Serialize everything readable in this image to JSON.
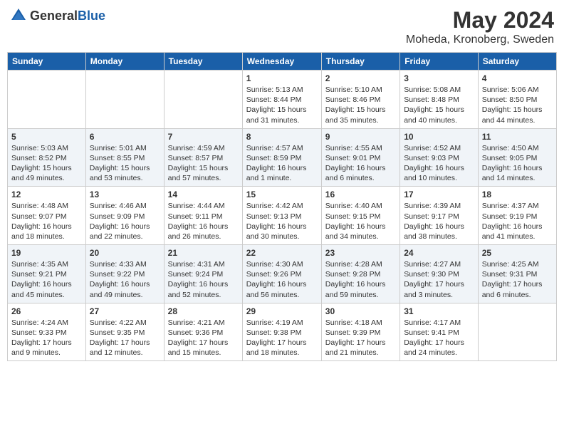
{
  "header": {
    "logo_general": "General",
    "logo_blue": "Blue",
    "month_year": "May 2024",
    "location": "Moheda, Kronoberg, Sweden"
  },
  "days_of_week": [
    "Sunday",
    "Monday",
    "Tuesday",
    "Wednesday",
    "Thursday",
    "Friday",
    "Saturday"
  ],
  "weeks": [
    [
      {
        "day": "",
        "info": ""
      },
      {
        "day": "",
        "info": ""
      },
      {
        "day": "",
        "info": ""
      },
      {
        "day": "1",
        "info": "Sunrise: 5:13 AM\nSunset: 8:44 PM\nDaylight: 15 hours and 31 minutes."
      },
      {
        "day": "2",
        "info": "Sunrise: 5:10 AM\nSunset: 8:46 PM\nDaylight: 15 hours and 35 minutes."
      },
      {
        "day": "3",
        "info": "Sunrise: 5:08 AM\nSunset: 8:48 PM\nDaylight: 15 hours and 40 minutes."
      },
      {
        "day": "4",
        "info": "Sunrise: 5:06 AM\nSunset: 8:50 PM\nDaylight: 15 hours and 44 minutes."
      }
    ],
    [
      {
        "day": "5",
        "info": "Sunrise: 5:03 AM\nSunset: 8:52 PM\nDaylight: 15 hours and 49 minutes."
      },
      {
        "day": "6",
        "info": "Sunrise: 5:01 AM\nSunset: 8:55 PM\nDaylight: 15 hours and 53 minutes."
      },
      {
        "day": "7",
        "info": "Sunrise: 4:59 AM\nSunset: 8:57 PM\nDaylight: 15 hours and 57 minutes."
      },
      {
        "day": "8",
        "info": "Sunrise: 4:57 AM\nSunset: 8:59 PM\nDaylight: 16 hours and 1 minute."
      },
      {
        "day": "9",
        "info": "Sunrise: 4:55 AM\nSunset: 9:01 PM\nDaylight: 16 hours and 6 minutes."
      },
      {
        "day": "10",
        "info": "Sunrise: 4:52 AM\nSunset: 9:03 PM\nDaylight: 16 hours and 10 minutes."
      },
      {
        "day": "11",
        "info": "Sunrise: 4:50 AM\nSunset: 9:05 PM\nDaylight: 16 hours and 14 minutes."
      }
    ],
    [
      {
        "day": "12",
        "info": "Sunrise: 4:48 AM\nSunset: 9:07 PM\nDaylight: 16 hours and 18 minutes."
      },
      {
        "day": "13",
        "info": "Sunrise: 4:46 AM\nSunset: 9:09 PM\nDaylight: 16 hours and 22 minutes."
      },
      {
        "day": "14",
        "info": "Sunrise: 4:44 AM\nSunset: 9:11 PM\nDaylight: 16 hours and 26 minutes."
      },
      {
        "day": "15",
        "info": "Sunrise: 4:42 AM\nSunset: 9:13 PM\nDaylight: 16 hours and 30 minutes."
      },
      {
        "day": "16",
        "info": "Sunrise: 4:40 AM\nSunset: 9:15 PM\nDaylight: 16 hours and 34 minutes."
      },
      {
        "day": "17",
        "info": "Sunrise: 4:39 AM\nSunset: 9:17 PM\nDaylight: 16 hours and 38 minutes."
      },
      {
        "day": "18",
        "info": "Sunrise: 4:37 AM\nSunset: 9:19 PM\nDaylight: 16 hours and 41 minutes."
      }
    ],
    [
      {
        "day": "19",
        "info": "Sunrise: 4:35 AM\nSunset: 9:21 PM\nDaylight: 16 hours and 45 minutes."
      },
      {
        "day": "20",
        "info": "Sunrise: 4:33 AM\nSunset: 9:22 PM\nDaylight: 16 hours and 49 minutes."
      },
      {
        "day": "21",
        "info": "Sunrise: 4:31 AM\nSunset: 9:24 PM\nDaylight: 16 hours and 52 minutes."
      },
      {
        "day": "22",
        "info": "Sunrise: 4:30 AM\nSunset: 9:26 PM\nDaylight: 16 hours and 56 minutes."
      },
      {
        "day": "23",
        "info": "Sunrise: 4:28 AM\nSunset: 9:28 PM\nDaylight: 16 hours and 59 minutes."
      },
      {
        "day": "24",
        "info": "Sunrise: 4:27 AM\nSunset: 9:30 PM\nDaylight: 17 hours and 3 minutes."
      },
      {
        "day": "25",
        "info": "Sunrise: 4:25 AM\nSunset: 9:31 PM\nDaylight: 17 hours and 6 minutes."
      }
    ],
    [
      {
        "day": "26",
        "info": "Sunrise: 4:24 AM\nSunset: 9:33 PM\nDaylight: 17 hours and 9 minutes."
      },
      {
        "day": "27",
        "info": "Sunrise: 4:22 AM\nSunset: 9:35 PM\nDaylight: 17 hours and 12 minutes."
      },
      {
        "day": "28",
        "info": "Sunrise: 4:21 AM\nSunset: 9:36 PM\nDaylight: 17 hours and 15 minutes."
      },
      {
        "day": "29",
        "info": "Sunrise: 4:19 AM\nSunset: 9:38 PM\nDaylight: 17 hours and 18 minutes."
      },
      {
        "day": "30",
        "info": "Sunrise: 4:18 AM\nSunset: 9:39 PM\nDaylight: 17 hours and 21 minutes."
      },
      {
        "day": "31",
        "info": "Sunrise: 4:17 AM\nSunset: 9:41 PM\nDaylight: 17 hours and 24 minutes."
      },
      {
        "day": "",
        "info": ""
      }
    ]
  ]
}
